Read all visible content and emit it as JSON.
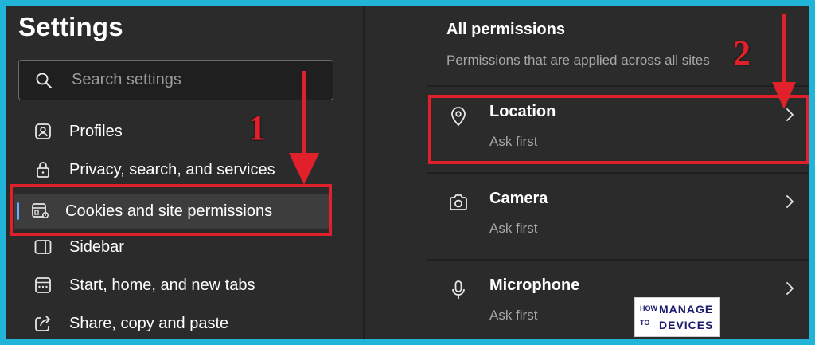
{
  "settings": {
    "title": "Settings",
    "search_placeholder": "Search settings",
    "nav": [
      {
        "label": "Profiles",
        "icon": "profile-icon"
      },
      {
        "label": "Privacy, search, and services",
        "icon": "lock-icon"
      },
      {
        "label": "Cookies and site permissions",
        "icon": "cookies-permissions-icon",
        "active": true
      },
      {
        "label": "Sidebar",
        "icon": "sidebar-icon"
      },
      {
        "label": "Start, home, and new tabs",
        "icon": "home-tabs-icon"
      },
      {
        "label": "Share, copy and paste",
        "icon": "share-icon"
      }
    ]
  },
  "permissions": {
    "title": "All permissions",
    "subtitle": "Permissions that are applied across all sites",
    "items": [
      {
        "name": "Location",
        "state": "Ask first",
        "icon": "location-pin-icon"
      },
      {
        "name": "Camera",
        "state": "Ask first",
        "icon": "camera-icon"
      },
      {
        "name": "Microphone",
        "state": "Ask first",
        "icon": "microphone-icon"
      }
    ]
  },
  "annotations": {
    "step1": "1",
    "step2": "2",
    "highlight_color": "#e0202a"
  },
  "watermark": {
    "line1": "HOW",
    "line2": "TO",
    "line3": "MANAGE",
    "line4": "DEVICES"
  },
  "colors": {
    "background": "#2b2b2b",
    "frame": "#1fb4d8",
    "accent": "#6ab0ff"
  }
}
